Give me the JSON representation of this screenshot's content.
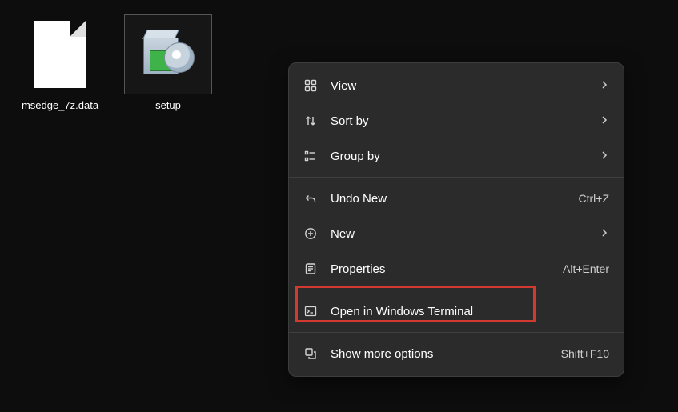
{
  "desktop": {
    "icons": [
      {
        "label": "msedge_7z.data"
      },
      {
        "label": "setup"
      }
    ]
  },
  "contextMenu": {
    "items": {
      "view": {
        "label": "View"
      },
      "sort": {
        "label": "Sort by"
      },
      "group": {
        "label": "Group by"
      },
      "undo": {
        "label": "Undo New",
        "shortcut": "Ctrl+Z"
      },
      "new": {
        "label": "New"
      },
      "properties": {
        "label": "Properties",
        "shortcut": "Alt+Enter"
      },
      "terminal": {
        "label": "Open in Windows Terminal"
      },
      "moreOptions": {
        "label": "Show more options",
        "shortcut": "Shift+F10"
      }
    }
  }
}
